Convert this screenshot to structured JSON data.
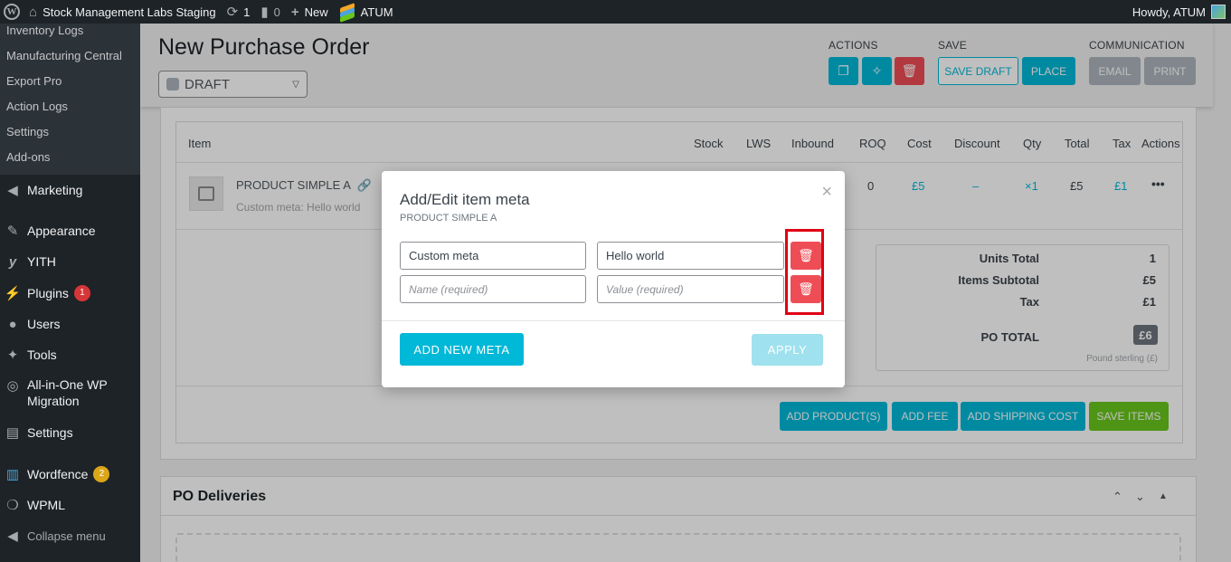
{
  "adminbar": {
    "site_name": "Stock Management Labs Staging",
    "updates_count": "1",
    "comments_count": "0",
    "new_label": "New",
    "atum_label": "ATUM",
    "howdy": "Howdy, ATUM"
  },
  "sidebar": {
    "submenu": [
      "Inventory Logs",
      "Manufacturing Central",
      "Export Pro",
      "Action Logs",
      "Settings",
      "Add-ons"
    ],
    "items": [
      {
        "label": "Marketing",
        "icon": "megaphone-icon"
      },
      {
        "label": "Appearance",
        "icon": "paintbrush-icon"
      },
      {
        "label": "YITH",
        "icon": "yith-icon"
      },
      {
        "label": "Plugins",
        "icon": "plugin-icon",
        "badge": "1"
      },
      {
        "label": "Users",
        "icon": "users-icon"
      },
      {
        "label": "Tools",
        "icon": "wrench-icon"
      },
      {
        "label": "All-in-One WP",
        "label2": "Migration",
        "icon": "migration-icon"
      },
      {
        "label": "Settings",
        "icon": "settings-icon"
      },
      {
        "label": "Wordfence",
        "icon": "wordfence-icon",
        "badge": "2"
      },
      {
        "label": "WPML",
        "icon": "wpml-icon"
      },
      {
        "label": "Collapse menu",
        "icon": "collapse-icon"
      }
    ]
  },
  "header": {
    "title": "New Purchase Order",
    "status": "DRAFT",
    "actions_label": "ACTIONS",
    "save_label": "SAVE",
    "communication_label": "COMMUNICATION",
    "save_draft": "SAVE DRAFT",
    "place": "PLACE",
    "email": "EMAIL",
    "print": "PRINT"
  },
  "items_table": {
    "columns": [
      "Item",
      "Stock",
      "LWS",
      "Inbound",
      "ROQ",
      "Cost",
      "Discount",
      "Qty",
      "Total",
      "Tax",
      "Actions"
    ],
    "row": {
      "name": "PRODUCT SIMPLE A",
      "meta": "Custom meta: Hello world",
      "roq": "0",
      "cost": "£5",
      "discount": "–",
      "qty": "×1",
      "total": "£5",
      "tax": "£1",
      "actions": "•••"
    }
  },
  "totals": {
    "units_total_label": "Units Total",
    "units_total": "1",
    "items_subtotal_label": "Items Subtotal",
    "items_subtotal": "£5",
    "tax_label": "Tax",
    "tax": "£1",
    "po_total_label": "PO TOTAL",
    "po_total": "£6",
    "currency_note": "Pound sterling (£)"
  },
  "bottom_buttons": {
    "add_products": "ADD PRODUCT(S)",
    "add_fee": "ADD FEE",
    "add_shipping": "ADD SHIPPING COST",
    "save_items": "SAVE ITEMS"
  },
  "deliveries": {
    "title": "PO Deliveries"
  },
  "modal": {
    "title": "Add/Edit item meta",
    "subtitle": "PRODUCT SIMPLE A",
    "rows": [
      {
        "name": "Custom meta",
        "value": "Hello world"
      },
      {
        "name_placeholder": "Name (required)",
        "value_placeholder": "Value (required)"
      }
    ],
    "add_new_meta": "ADD NEW META",
    "apply": "APPLY",
    "close": "×"
  },
  "colors": {
    "teal": "#00b8d8",
    "danger": "#ef4d56",
    "success": "#69c61d",
    "highlight": "#e00014"
  }
}
